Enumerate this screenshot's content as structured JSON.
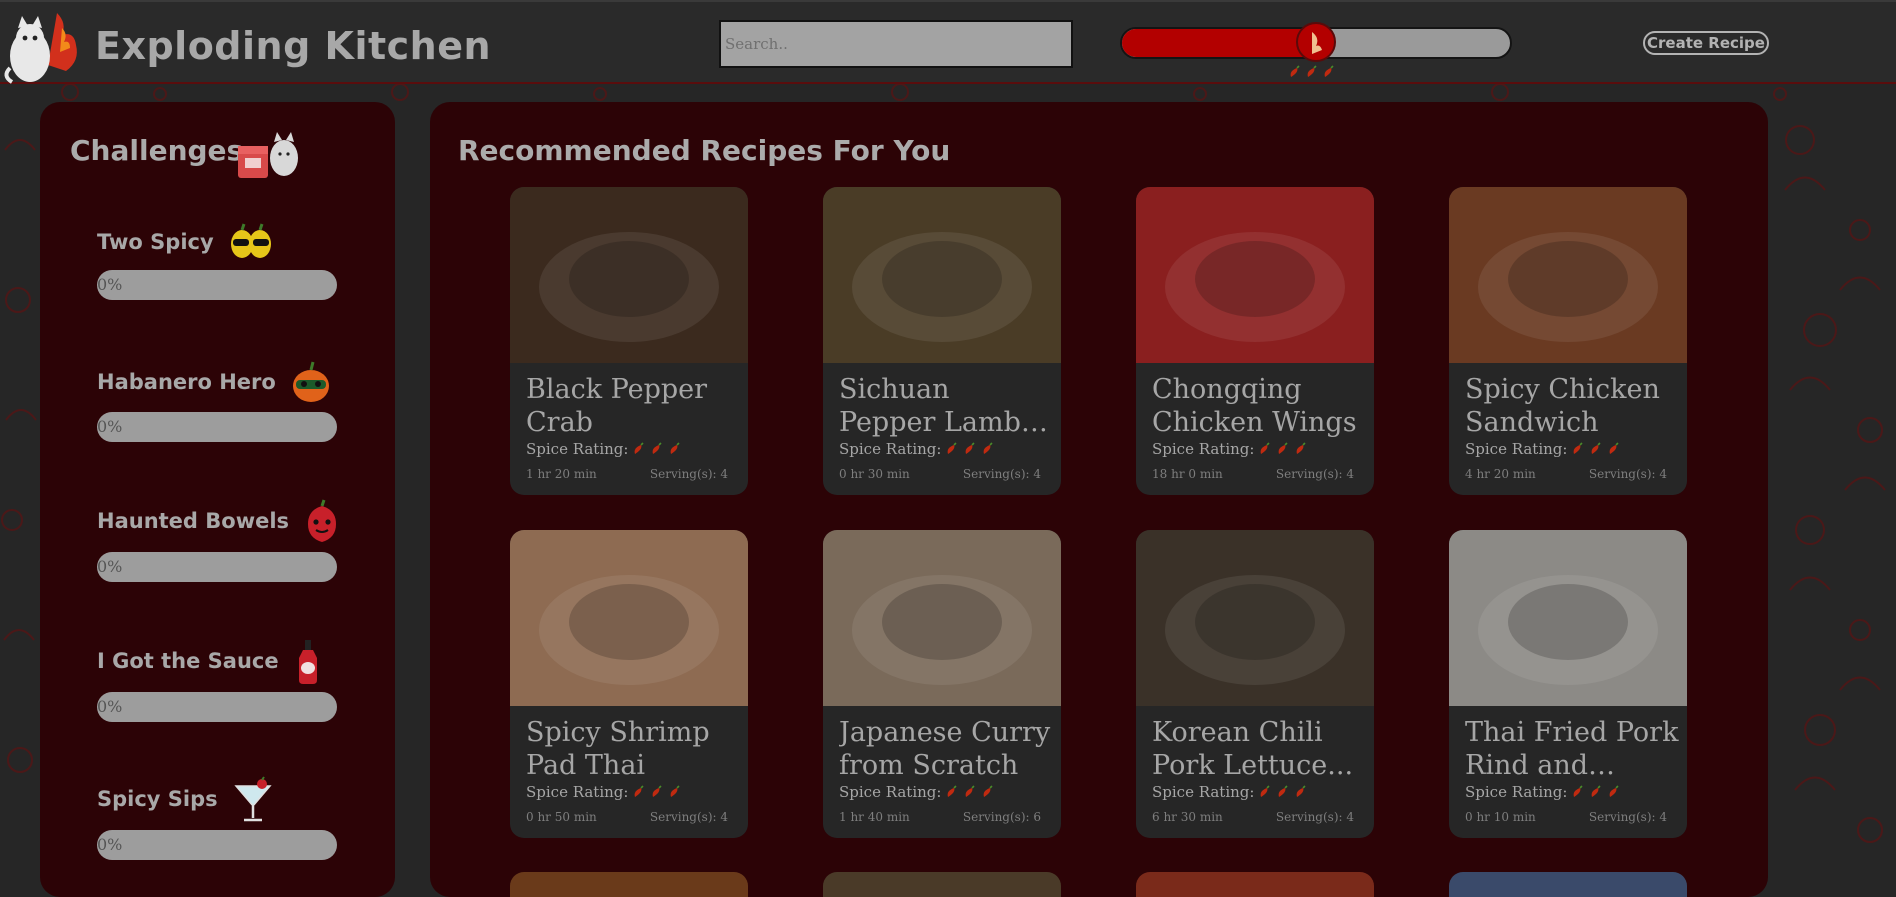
{
  "header": {
    "app_title": "Exploding Kitchen",
    "search_placeholder": "Search..",
    "spice_level": 0.5,
    "create_recipe_label": "Create Recipe"
  },
  "challenges": {
    "title": "Challenges",
    "items": [
      {
        "name": "Two Spicy",
        "progress": "0%",
        "icon": "twin-peppers-sunglasses-icon"
      },
      {
        "name": "Habanero Hero",
        "progress": "0%",
        "icon": "habanero-mask-icon"
      },
      {
        "name": "Haunted Bowels",
        "progress": "0%",
        "icon": "ghost-pepper-icon"
      },
      {
        "name": "I Got the Sauce",
        "progress": "0%",
        "icon": "hot-sauce-bottle-icon"
      },
      {
        "name": "Spicy Sips",
        "progress": "0%",
        "icon": "cocktail-glass-icon"
      }
    ]
  },
  "recommended": {
    "title": "Recommended Recipes For You",
    "spice_label": "Spice Rating:",
    "recipes": [
      {
        "title": "Black Pepper Crab",
        "time": "1 hr 20 min",
        "servings": "Serving(s): 4",
        "img_color": "#3b2a1e"
      },
      {
        "title": "Sichuan Pepper Lamb and...",
        "time": "0 hr 30 min",
        "servings": "Serving(s): 4",
        "img_color": "#4a3c26"
      },
      {
        "title": "Chongqing Chicken Wings",
        "time": "18 hr 0 min",
        "servings": "Serving(s): 4",
        "img_color": "#8a1f1f"
      },
      {
        "title": "Spicy Chicken Sandwich",
        "time": "4 hr 20 min",
        "servings": "Serving(s): 4",
        "img_color": "#6a3a22"
      },
      {
        "title": "Spicy Shrimp Pad Thai",
        "time": "0 hr 50 min",
        "servings": "Serving(s): 4",
        "img_color": "#8e6b52"
      },
      {
        "title": "Japanese Curry from Scratch",
        "time": "1 hr 40 min",
        "servings": "Serving(s): 6",
        "img_color": "#7a6a5a"
      },
      {
        "title": "Korean Chili Pork Lettuce...",
        "time": "6 hr 30 min",
        "servings": "Serving(s): 4",
        "img_color": "#3a3128"
      },
      {
        "title": "Thai Fried Pork Rind and Herb...",
        "time": "0 hr 10 min",
        "servings": "Serving(s): 4",
        "img_color": "#8c8a86"
      }
    ]
  },
  "colors": {
    "accent_red": "#b30000",
    "panel_bg": "#2c0306",
    "page_bg": "#262626"
  }
}
